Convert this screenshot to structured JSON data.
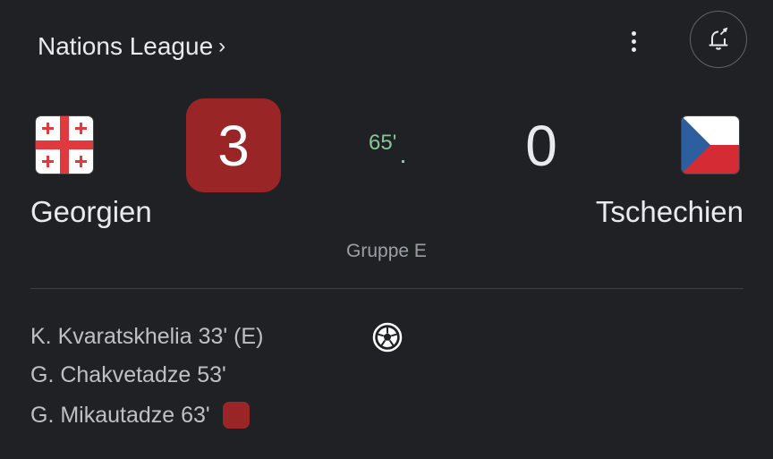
{
  "header": {
    "competition": "Nations League",
    "chevron": "›",
    "more_icon": "more-vert-icon",
    "alert_icon": "bell-add-icon"
  },
  "match": {
    "home": {
      "name": "Georgien",
      "score": "3",
      "flag_icon": "georgia-flag-icon"
    },
    "away": {
      "name": "Tschechien",
      "score": "0",
      "flag_icon": "czech-flag-icon"
    },
    "minute": "65'",
    "group": "Gruppe E"
  },
  "events": {
    "home_scorers": [
      {
        "text": "K. Kvaratskhelia 33' (E)"
      },
      {
        "text": "G. Chakvetadze 53'"
      },
      {
        "text": "G. Mikautadze 63'",
        "card": "red-card-icon"
      }
    ],
    "goal_icon": "soccer-ball-icon"
  },
  "colors": {
    "background": "#202124",
    "score_highlight": "#9a2527",
    "live_minute": "#81c995",
    "muted_text": "#9aa0a6"
  }
}
